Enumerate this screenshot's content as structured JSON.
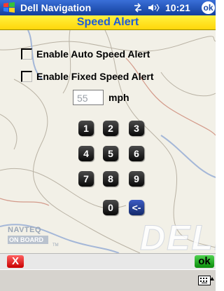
{
  "titlebar": {
    "title": "Dell Navigation",
    "time": "10:21",
    "ok_label": "ok",
    "icons": [
      "windows-start-icon",
      "connectivity-icon",
      "volume-icon"
    ]
  },
  "header": {
    "title": "Speed Alert"
  },
  "options": {
    "auto_label": "Enable Auto Speed Alert",
    "auto_checked": false,
    "fixed_label": "Enable Fixed Speed Alert",
    "fixed_checked": false
  },
  "speed": {
    "value": "55",
    "unit": "mph"
  },
  "keypad": {
    "keys": [
      "1",
      "2",
      "3",
      "4",
      "5",
      "6",
      "7",
      "8",
      "9",
      "0"
    ],
    "backspace": "<-"
  },
  "map": {
    "brand_top": "NAVTEQ",
    "brand_bottom": "ON BOARD",
    "tm": "TM",
    "watermark": "DELL"
  },
  "bottom": {
    "cancel_label": "X",
    "ok_label": "ok"
  },
  "colors": {
    "title_bar": "#1c4aa8",
    "header_bg": "#ffe81f",
    "header_text": "#1e5cd8",
    "key_bg": "#1a1a1a",
    "backspace_bg": "#1f3b90",
    "cancel": "#e01010",
    "ok": "#22b022"
  }
}
